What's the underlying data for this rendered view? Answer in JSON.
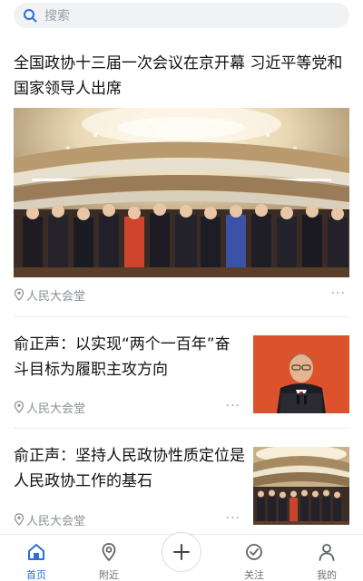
{
  "search": {
    "placeholder": "搜索",
    "icon": "search-icon"
  },
  "feed": {
    "featured": {
      "title": "全国政协十三届一次会议在京开幕 习近平等党和国家领导人出席",
      "location": "人民大会堂",
      "more": "···"
    },
    "items": [
      {
        "title": "俞正声：以实现“两个一百年”奋斗目标为履职主攻方向",
        "location": "人民大会堂",
        "more": "···"
      },
      {
        "title": "俞正声：坚持人民政协性质定位是人民政协工作的基石",
        "location": "人民大会堂",
        "more": "···"
      }
    ]
  },
  "tabbar": {
    "tabs": [
      {
        "label": "首页",
        "icon": "home-icon",
        "active": true
      },
      {
        "label": "附近",
        "icon": "location-icon",
        "active": false
      },
      {
        "label": "",
        "icon": "plus-icon",
        "active": false
      },
      {
        "label": "关注",
        "icon": "follow-icon",
        "active": false
      },
      {
        "label": "我的",
        "icon": "profile-icon",
        "active": false
      }
    ]
  },
  "colors": {
    "accent": "#2a6fdb",
    "muted": "#8a8f95"
  }
}
